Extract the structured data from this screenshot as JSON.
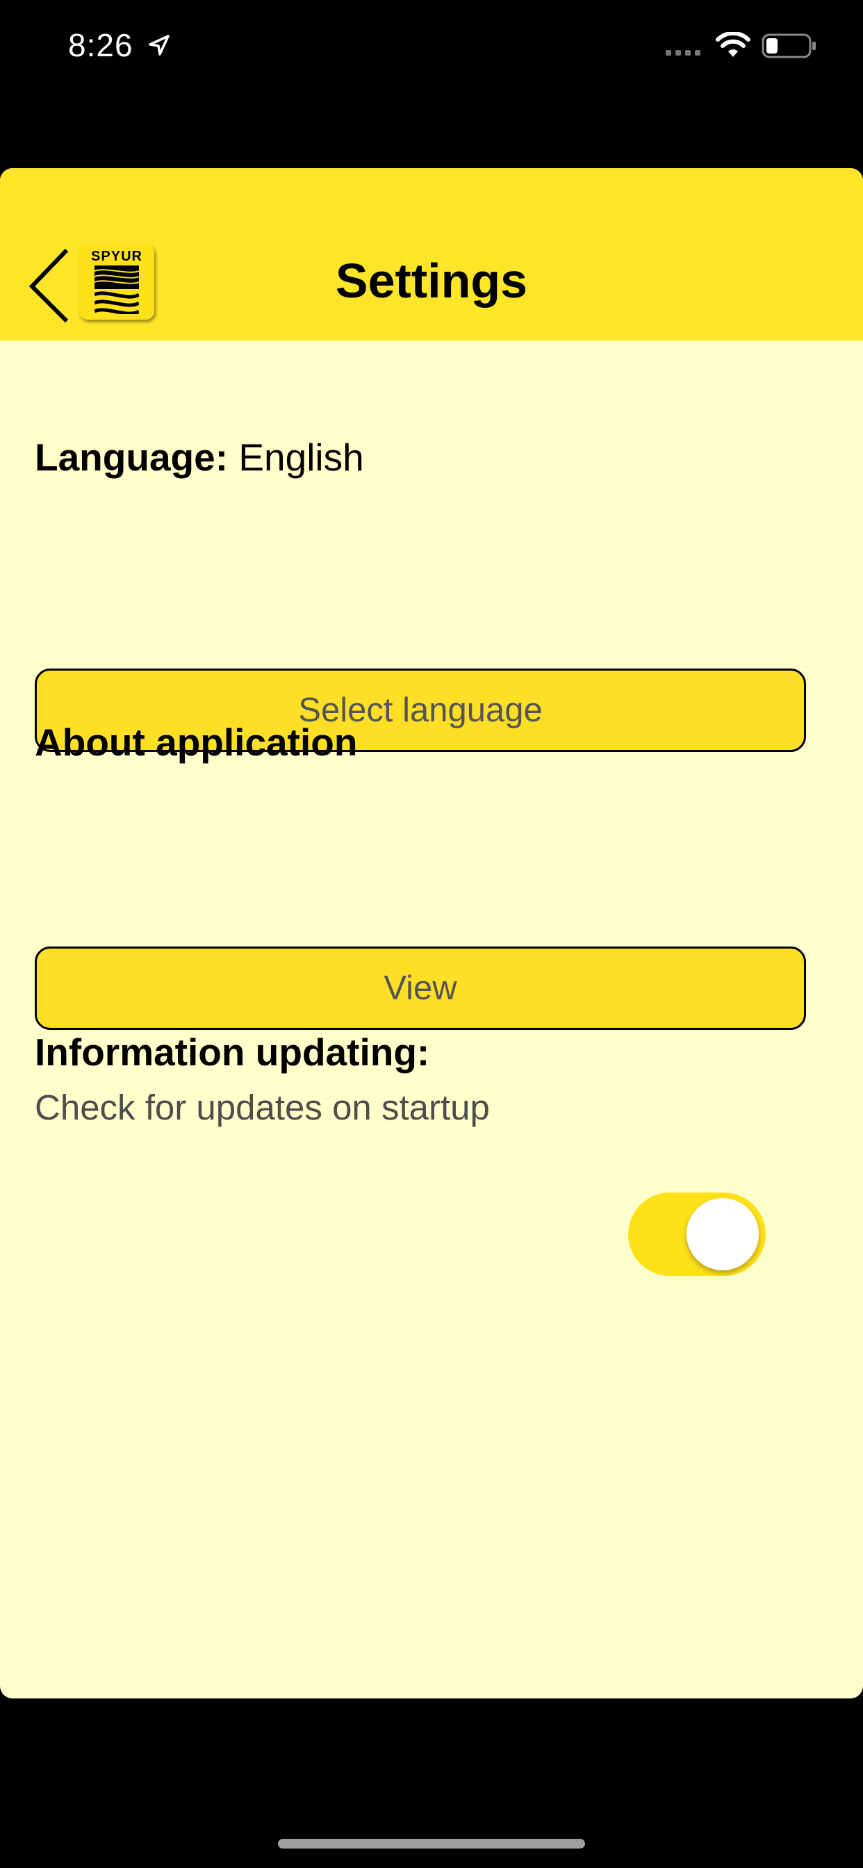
{
  "status_bar": {
    "time": "8:26"
  },
  "header": {
    "title": "Settings",
    "logo_text": "SPYUR"
  },
  "language": {
    "label": "Language:",
    "value": "English",
    "button_label": "Select language"
  },
  "about": {
    "label": "About application",
    "button_label": "View"
  },
  "updating": {
    "label": "Information updating:",
    "description": "Check for updates on startup",
    "toggle_on": true
  },
  "colors": {
    "header_background": "#ffe528",
    "screen_background": "#ffffcc",
    "button_background": "#ffdf26",
    "toggle_on": "#ffe11a"
  }
}
